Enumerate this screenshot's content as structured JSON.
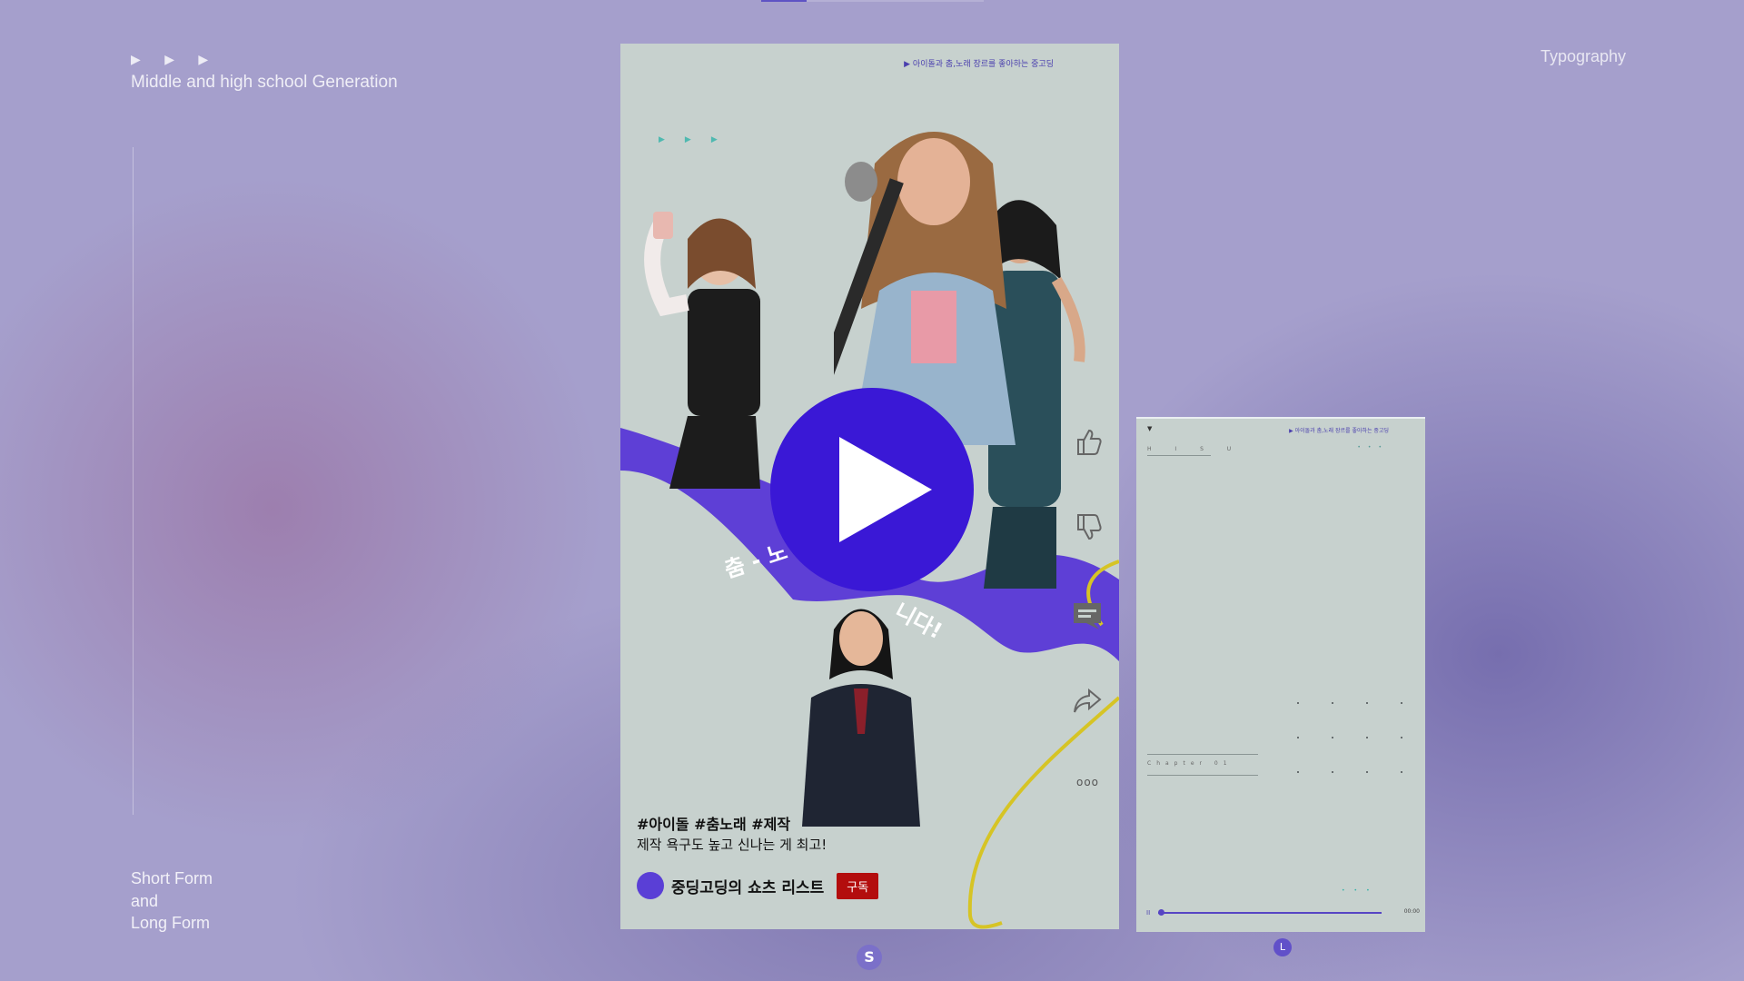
{
  "header": {
    "arrows": "▶ ▶ ▶",
    "subtitle": "Middle and high school Generation",
    "right_label": "Typography"
  },
  "left_footer": {
    "line1": "Short Form",
    "line2": "and",
    "line3": "Long Form"
  },
  "short_form": {
    "top_caption": "▶ 아이돌과 춤,노래 장르를 좋아하는 중고딩",
    "wave_text_left": "춤 - 노",
    "wave_text_right": "니다!",
    "hashtags": "#아이돌 #춤노래 #제작",
    "description": "제작 욕구도 높고 신나는 게 최고!",
    "channel_name": "중딩고딩의 쇼츠 리스트",
    "subscribe_label": "구독",
    "more_label": "ooo",
    "badge": "S",
    "icons": [
      "thumbs-up-icon",
      "thumbs-down-icon",
      "comment-icon",
      "share-icon"
    ]
  },
  "long_form": {
    "top_caption": "▶ 아이돌과 춤,노래 장르를 좋아하는 중고딩",
    "caret": "▼",
    "menu": "H I S U",
    "chapter": "Chapter 01",
    "time": "00:00",
    "badge": "L",
    "pause_symbol": "II"
  },
  "colors": {
    "accent_purple": "#5e3fd6",
    "play_blue": "#3a18d6",
    "subscribe_red": "#b30d0d",
    "phone_bg": "#c7d1ce",
    "wave_yellow": "#d6c425"
  }
}
